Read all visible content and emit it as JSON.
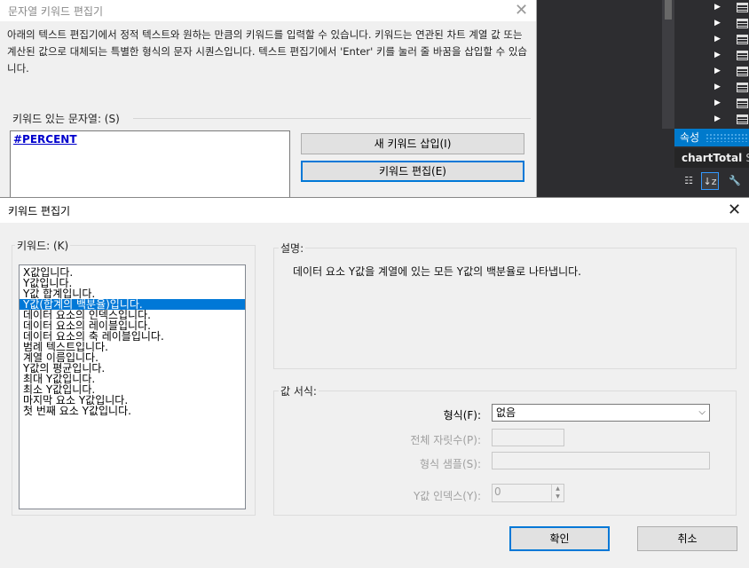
{
  "string_dialog": {
    "title": "문자열 키워드 편집기",
    "close_glyph": "✕",
    "description": "아래의 텍스트 편집기에서 정적 텍스트와 원하는 만큼의 키워드를 입력할 수 있습니다. 키워드는 연관된 차트 계열 값 또는 계산된 값으로 대체되는 특별한 형식의 문자 시퀀스입니다. 텍스트 편집기에서 'Enter' 키를 눌러 줄 바꿈을 삽입할 수 있습니다.",
    "group_label": "키워드 있는 문자열: (S)",
    "text_value": "#PERCENT",
    "insert_button": "새 키워드 삽입(I)",
    "edit_button": "키워드 편집(E)"
  },
  "ide": {
    "properties_header": "속성",
    "object_name": "chartTotal",
    "object_type": "Sy",
    "tree_arrow": "▶",
    "tree_rows": 8,
    "tool_categorized": "☷",
    "tool_alphabetical": "↓z",
    "tool_properties": "🔧"
  },
  "keyword_dialog": {
    "title": "키워드 편집기",
    "close_glyph": "✕",
    "keywords_label": "키워드: (K)",
    "keywords": [
      "X값입니다.",
      "Y값입니다.",
      "Y값 합계입니다.",
      "Y값(합계의 백분율)입니다.",
      "데이터 요소의 인덱스입니다.",
      "데이터 요소의 레이블입니다.",
      "데이터 요소의 축 레이블입니다.",
      "범례 텍스트입니다.",
      "계열 이름입니다.",
      "Y값의 평균입니다.",
      "최대 Y값입니다.",
      "최소 Y값입니다.",
      "마지막 요소 Y값입니다.",
      "첫 번째 요소 Y값입니다."
    ],
    "selected_index": 3,
    "description_label": "설명:",
    "description_text": "데이터 요소 Y값을 계열에 있는 모든 Y값의 백분율로 나타냅니다.",
    "format_group_label": "값 서식:",
    "format_label": "형식(F):",
    "format_value": "없음",
    "precision_label": "전체 자릿수(P):",
    "sample_label": "형식 샘플(S):",
    "yindex_label": "Y값 인덱스(Y):",
    "yindex_value": "0",
    "ok_button": "확인",
    "cancel_button": "취소"
  },
  "colors": {
    "accent": "#0078d7",
    "ide_header": "#007acc",
    "dialog_bg": "#f0f0f0"
  }
}
